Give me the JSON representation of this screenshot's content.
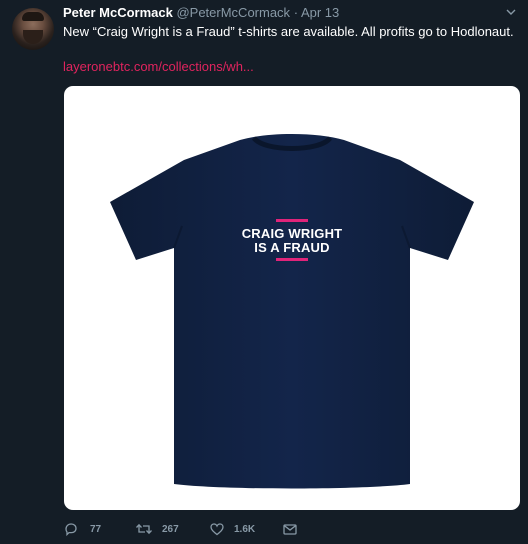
{
  "tweet": {
    "author_name": "Peter McCormack",
    "author_handle": "@PeterMcCormack",
    "separator": "·",
    "date": "Apr 13",
    "text": "New “Craig Wright is a Fraud” t-shirts are available. All profits go to Hodlonaut.",
    "link": "layeronebtc.com/collections/wh...",
    "caret_icon": "chevron-down-icon"
  },
  "media": {
    "shirt_line_1": "CRAIG WRIGHT",
    "shirt_line_2": "IS A FRAUD",
    "shirt_color": "#10203d",
    "accent_color": "#e0247a"
  },
  "actions": {
    "reply_count": "77",
    "retweet_count": "267",
    "like_count": "1.6K",
    "reply_icon": "reply-icon",
    "retweet_icon": "retweet-icon",
    "like_icon": "heart-icon",
    "dm_icon": "envelope-icon"
  },
  "colors": {
    "background": "#141d26",
    "secondary_text": "#8899a6",
    "link": "#e0245e"
  }
}
